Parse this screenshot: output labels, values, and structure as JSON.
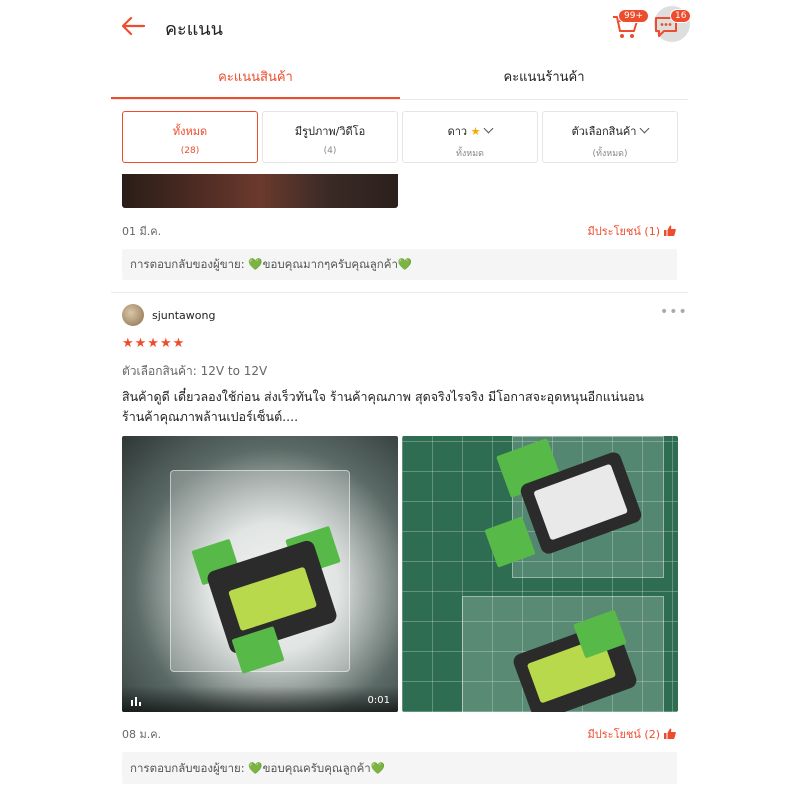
{
  "header": {
    "title": "คะแนน",
    "cart_badge": "99+",
    "chat_badge": "16"
  },
  "tabs": [
    {
      "label": "คะแนนสินค้า",
      "active": true
    },
    {
      "label": "คะแนนร้านค้า",
      "active": false
    }
  ],
  "filters": [
    {
      "label": "ทั้งหมด",
      "sub": "(28)",
      "active": true
    },
    {
      "label": "มีรูปภาพ/วิดีโอ",
      "sub": "(4)"
    },
    {
      "label": "ดาว",
      "sub": "ทั้งหมด"
    },
    {
      "label": "ตัวเลือกสินค้า",
      "sub": "(ทั้งหมด)"
    }
  ],
  "reviews": [
    {
      "date": "01 มี.ค.",
      "helpful": "มีประโยชน์ (1)",
      "seller_reply": "การตอบกลับของผู้ขาย: 💚ขอบคุณมากๆครับคุณลูกค้า💚"
    },
    {
      "username": "sjuntawong",
      "rating": 5,
      "stars_text": "★★★★★",
      "variant": "ตัวเลือกสินค้า: 12V to 12V",
      "comment_line1": "สินค้าดูดี เดี๋ยวลองใช้ก่อน ส่งเร็วทันใจ ร้านค้าคุณภาพ สุดจริงไรจริง มีโอกาสจะอุดหนุนอีกแน่นอน",
      "comment_line2": "ร้านค้าคุณภาพล้านเปอร์เซ็นต์....",
      "video_time": "0:01",
      "date": "08 ม.ค.",
      "helpful": "มีประโยชน์ (2)",
      "seller_reply": "การตอบกลับของผู้ขาย: 💚ขอบคุณครับคุณลูกค้า💚"
    }
  ],
  "colors": {
    "accent": "#ee4d2d",
    "reply_bg": "#f5f5f5"
  }
}
